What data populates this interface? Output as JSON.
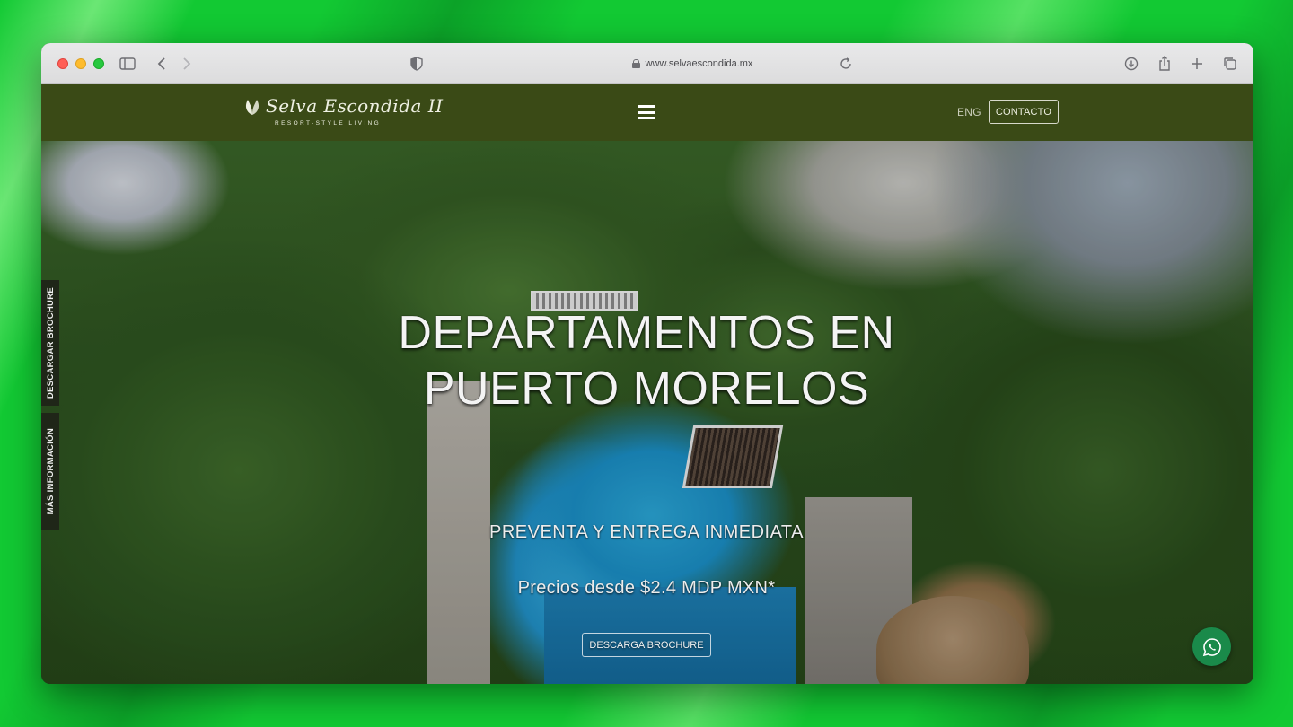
{
  "browser": {
    "url": "www.selvaescondida.mx"
  },
  "header": {
    "logo_name": "Selva Escondida II",
    "logo_tagline": "RESORT-STYLE LIVING",
    "lang_label": "ENG",
    "contact_label": "CONTACTO"
  },
  "side_tabs": {
    "brochure": "DESCARGAR BROCHURE",
    "info": "MÁS INFORMACIÓN"
  },
  "hero": {
    "title_line1": "DEPARTAMENTOS EN",
    "title_line2": "PUERTO MORELOS",
    "subtitle": "PREVENTA Y ENTREGA INMEDIATA",
    "price": "Precios desde $2.4 MDP MXN*",
    "cta_label": "DESCARGA BROCHURE"
  },
  "colors": {
    "header_bg": "#3a4a16",
    "whatsapp": "#1a8a4a",
    "backdrop": "#12c933"
  },
  "icons": [
    "sidebar-icon",
    "back-arrow-icon",
    "forward-arrow-icon",
    "shield-icon",
    "lock-icon",
    "reload-icon",
    "download-icon",
    "share-icon",
    "plus-icon",
    "tabs-icon",
    "menu-icon",
    "leaf-logo-icon",
    "whatsapp-icon"
  ]
}
